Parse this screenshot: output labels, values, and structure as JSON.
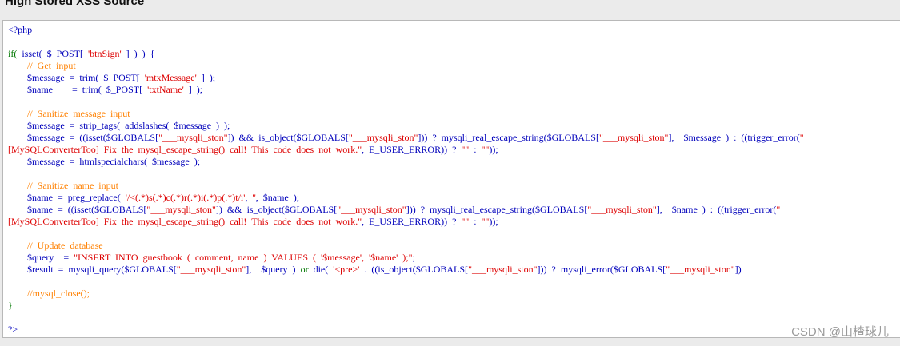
{
  "page": {
    "title": "High Stored XSS Source",
    "watermark": "CSDN @山楂球儿"
  },
  "code": {
    "open_tag": "<?php",
    "close_tag": "?>",
    "lines": [
      [
        {
          "c": "tag",
          "t": "<?php"
        }
      ],
      [],
      [
        {
          "c": "kw",
          "t": "if(  "
        },
        {
          "c": "def",
          "t": "isset(  $_POST[  "
        },
        {
          "c": "str",
          "t": "'btnSign'"
        },
        {
          "c": "def",
          "t": "  ]  )  )  {"
        }
      ],
      [
        {
          "c": "def",
          "t": "        "
        },
        {
          "c": "cm",
          "t": "//  Get  input"
        }
      ],
      [
        {
          "c": "def",
          "t": "        $message  =  trim(  $_POST[  "
        },
        {
          "c": "str",
          "t": "'mtxMessage'"
        },
        {
          "c": "def",
          "t": "  ]  );"
        }
      ],
      [
        {
          "c": "def",
          "t": "        $name        =  trim(  $_POST[  "
        },
        {
          "c": "str",
          "t": "'txtName'"
        },
        {
          "c": "def",
          "t": "  ]  );"
        }
      ],
      [],
      [
        {
          "c": "def",
          "t": "        "
        },
        {
          "c": "cm",
          "t": "//  Sanitize  message  input"
        }
      ],
      [
        {
          "c": "def",
          "t": "        $message  =  strip_tags(  addslashes(  $message  )  );"
        }
      ],
      [
        {
          "c": "def",
          "t": "        $message  =  ((isset($GLOBALS["
        },
        {
          "c": "str",
          "t": "\"___mysqli_ston\""
        },
        {
          "c": "def",
          "t": "])  &&  is_object($GLOBALS["
        },
        {
          "c": "str",
          "t": "\"___mysqli_ston\""
        },
        {
          "c": "def",
          "t": "]))  ?  mysqli_real_escape_string($GLOBALS["
        },
        {
          "c": "str",
          "t": "\"___mysqli_ston\""
        },
        {
          "c": "def",
          "t": "],    $message  )  :  ((trigger_error("
        },
        {
          "c": "str",
          "t": "\""
        }
      ],
      [
        {
          "c": "str",
          "t": "[MySQLConverterToo]  Fix  the  mysql_escape_string()  call!  This  code  does  not  work.\""
        },
        {
          "c": "def",
          "t": ",  E_USER_ERROR))  ?  "
        },
        {
          "c": "str",
          "t": "\"\""
        },
        {
          "c": "def",
          "t": "  :  "
        },
        {
          "c": "str",
          "t": "\"\""
        },
        {
          "c": "def",
          "t": "));"
        }
      ],
      [
        {
          "c": "def",
          "t": "        $message  =  htmlspecialchars(  $message  );"
        }
      ],
      [],
      [
        {
          "c": "def",
          "t": "        "
        },
        {
          "c": "cm",
          "t": "//  Sanitize  name  input"
        }
      ],
      [
        {
          "c": "def",
          "t": "        $name  =  preg_replace(  "
        },
        {
          "c": "str",
          "t": "'/<(.*)s(.*)c(.*)r(.*)i(.*)p(.*)t/i'"
        },
        {
          "c": "def",
          "t": ",  "
        },
        {
          "c": "str",
          "t": "''"
        },
        {
          "c": "def",
          "t": ",  $name  );"
        }
      ],
      [
        {
          "c": "def",
          "t": "        $name  =  ((isset($GLOBALS["
        },
        {
          "c": "str",
          "t": "\"___mysqli_ston\""
        },
        {
          "c": "def",
          "t": "])  &&  is_object($GLOBALS["
        },
        {
          "c": "str",
          "t": "\"___mysqli_ston\""
        },
        {
          "c": "def",
          "t": "]))  ?  mysqli_real_escape_string($GLOBALS["
        },
        {
          "c": "str",
          "t": "\"___mysqli_ston\""
        },
        {
          "c": "def",
          "t": "],    $name  )  :  ((trigger_error("
        },
        {
          "c": "str",
          "t": "\""
        }
      ],
      [
        {
          "c": "str",
          "t": "[MySQLConverterToo]  Fix  the  mysql_escape_string()  call!  This  code  does  not  work.\""
        },
        {
          "c": "def",
          "t": ",  E_USER_ERROR))  ?  "
        },
        {
          "c": "str",
          "t": "\"\""
        },
        {
          "c": "def",
          "t": "  :  "
        },
        {
          "c": "str",
          "t": "\"\""
        },
        {
          "c": "def",
          "t": "));"
        }
      ],
      [],
      [
        {
          "c": "def",
          "t": "        "
        },
        {
          "c": "cm",
          "t": "//  Update  database"
        }
      ],
      [
        {
          "c": "def",
          "t": "        $query    =  "
        },
        {
          "c": "str",
          "t": "\"INSERT  INTO  guestbook  (  comment,  name  )  VALUES  (  '$message',  '$name'  );\""
        },
        {
          "c": "def",
          "t": ";"
        }
      ],
      [
        {
          "c": "def",
          "t": "        $result  =  mysqli_query($GLOBALS["
        },
        {
          "c": "str",
          "t": "\"___mysqli_ston\""
        },
        {
          "c": "def",
          "t": "],    $query  )  "
        },
        {
          "c": "kw",
          "t": "or  "
        },
        {
          "c": "def",
          "t": "die(  "
        },
        {
          "c": "str",
          "t": "'<pre>'"
        },
        {
          "c": "def",
          "t": "  .  ((is_object($GLOBALS["
        },
        {
          "c": "str",
          "t": "\"___mysqli_ston\""
        },
        {
          "c": "def",
          "t": "]))  ?  mysqli_error($GLOBALS["
        },
        {
          "c": "str",
          "t": "\"___mysqli_ston\""
        },
        {
          "c": "def",
          "t": "])"
        }
      ],
      [],
      [
        {
          "c": "def",
          "t": "        "
        },
        {
          "c": "cm",
          "t": "//mysql_close();"
        }
      ],
      [
        {
          "c": "kw",
          "t": "}"
        }
      ],
      [],
      [
        {
          "c": "tag",
          "t": "?>"
        }
      ]
    ]
  }
}
